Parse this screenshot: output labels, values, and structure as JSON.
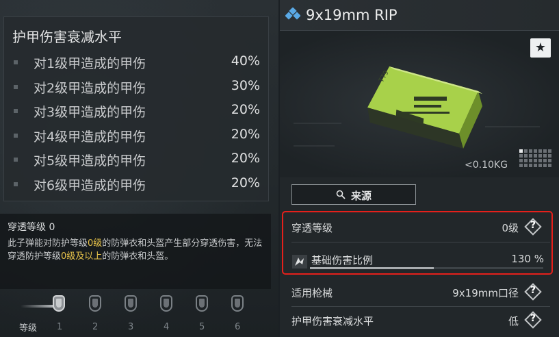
{
  "armor_damage": {
    "title": "护甲伤害衰减水平",
    "rows": [
      {
        "label": "对1级甲造成的甲伤",
        "value": "40%"
      },
      {
        "label": "对2级甲造成的甲伤",
        "value": "30%"
      },
      {
        "label": "对3级甲造成的甲伤",
        "value": "20%"
      },
      {
        "label": "对4级甲造成的甲伤",
        "value": "20%"
      },
      {
        "label": "对5级甲造成的甲伤",
        "value": "20%"
      },
      {
        "label": "对6级甲造成的甲伤",
        "value": "20%"
      }
    ]
  },
  "penetration": {
    "title": "穿透等级 0",
    "desc": {
      "p1": "此子弹能对防护等级",
      "h1": "0级",
      "p2": "的防弹衣和头盔产生部分穿透伤害，无法穿透防护等级",
      "h2": "0级及以上",
      "p3": "的防弹衣和头盔。"
    }
  },
  "level_scale": {
    "label": "等级",
    "levels": [
      "1",
      "2",
      "3",
      "4",
      "5",
      "6"
    ],
    "active_level": 0
  },
  "item": {
    "name": "9x19mm RIP",
    "weight": "<0.10KG",
    "icon": "ammo-diamond-icon",
    "favorite_glyph": "★"
  },
  "source_button": {
    "label": "来源",
    "icon": "search-icon"
  },
  "stats": {
    "penetration": {
      "label": "穿透等级",
      "value": "0级",
      "help": "?"
    },
    "base_damage": {
      "label": "基础伤害比例",
      "value": "130 %",
      "icon": "damage-burst-icon",
      "bar_fraction": 0.53
    },
    "weapon": {
      "label": "适用枪械",
      "value": "9x19mm口径",
      "help": "?"
    },
    "armor_level": {
      "label": "护甲伤害衰减水平",
      "value": "低",
      "help": "?"
    }
  },
  "colors": {
    "highlight": "#e6c24a",
    "callout_border": "#e5201b",
    "ammo_box": "#a8d14a"
  }
}
